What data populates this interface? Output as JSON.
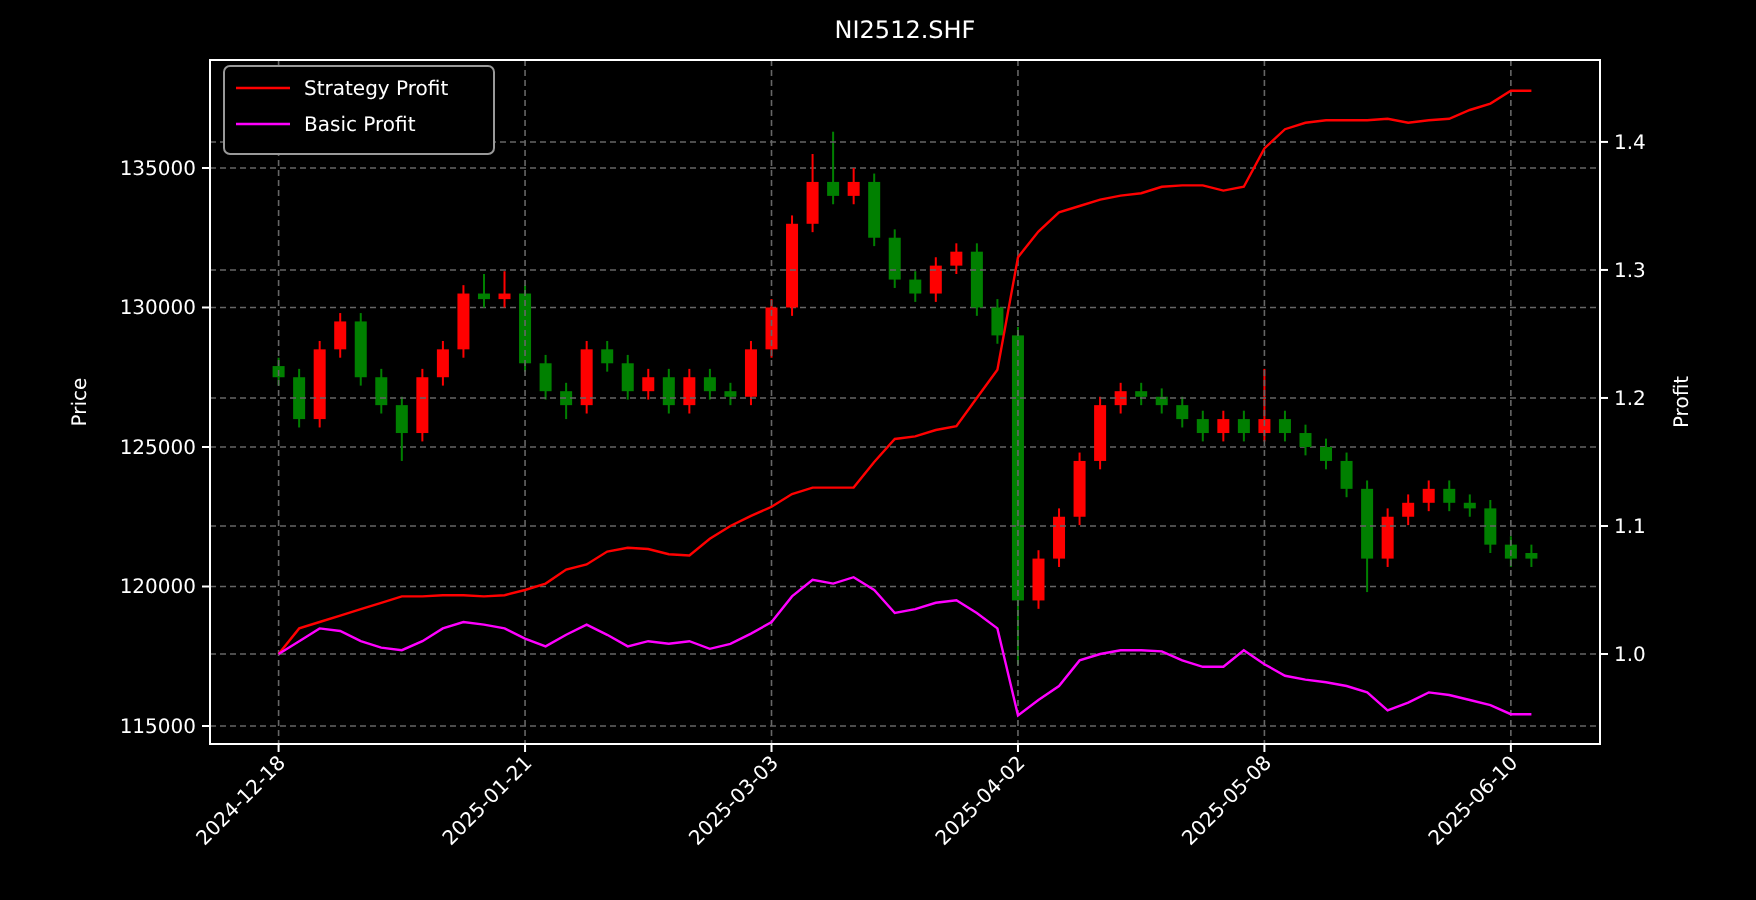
{
  "profit_chart": {
    "chart_data": {
      "type": "line",
      "title": "NI2512.SHF",
      "ylabel": "Profit",
      "grid": true,
      "legend": true,
      "categories": [
        "2024-12-18",
        null,
        null,
        null,
        null,
        null,
        null,
        null,
        null,
        null,
        null,
        null,
        "2025-01-21",
        null,
        null,
        null,
        null,
        null,
        null,
        null,
        null,
        null,
        null,
        null,
        "2025-03-03",
        null,
        null,
        null,
        null,
        null,
        null,
        null,
        null,
        null,
        null,
        null,
        "2025-04-02",
        null,
        null,
        null,
        null,
        null,
        null,
        null,
        null,
        null,
        null,
        null,
        "2025-05-08",
        null,
        null,
        null,
        null,
        null,
        null,
        null,
        null,
        null,
        null,
        null,
        "2025-06-10",
        null
      ],
      "ylim": [
        0.9297,
        1.464
      ],
      "yticks": [
        {
          "value": 1.0,
          "label": "1.0"
        },
        {
          "value": 1.1,
          "label": "1.1"
        },
        {
          "value": 1.2,
          "label": "1.2"
        },
        {
          "value": 1.3,
          "label": "1.3"
        },
        {
          "value": 1.4,
          "label": "1.4"
        }
      ],
      "series": [
        {
          "name": "Strategy Profit",
          "color": "#ff0000",
          "values": [
            1.0,
            1.02,
            1.025,
            1.03,
            1.035,
            1.04,
            1.045,
            1.045,
            1.046,
            1.046,
            1.045,
            1.046,
            1.05,
            1.055,
            1.066,
            1.07,
            1.08,
            1.083,
            1.082,
            1.078,
            1.077,
            1.09,
            1.1,
            1.108,
            1.115,
            1.125,
            1.13,
            1.13,
            1.13,
            1.15,
            1.168,
            1.17,
            1.175,
            1.178,
            1.2,
            1.222,
            1.31,
            1.33,
            1.345,
            1.35,
            1.355,
            1.358,
            1.36,
            1.365,
            1.366,
            1.366,
            1.362,
            1.365,
            1.395,
            1.41,
            1.415,
            1.417,
            1.417,
            1.417,
            1.418,
            1.415,
            1.417,
            1.418,
            1.425,
            1.43,
            1.44,
            1.44
          ]
        },
        {
          "name": "Basic Profit",
          "color": "#ff00ff",
          "values": [
            1.0,
            1.01,
            1.02,
            1.018,
            1.01,
            1.005,
            1.003,
            1.01,
            1.02,
            1.025,
            1.023,
            1.02,
            1.012,
            1.006,
            1.015,
            1.023,
            1.015,
            1.006,
            1.01,
            1.008,
            1.01,
            1.004,
            1.008,
            1.016,
            1.025,
            1.045,
            1.058,
            1.055,
            1.06,
            1.05,
            1.032,
            1.035,
            1.04,
            1.042,
            1.032,
            1.02,
            0.952,
            0.964,
            0.975,
            0.995,
            1.0,
            1.003,
            1.003,
            1.002,
            0.995,
            0.99,
            0.99,
            1.003,
            0.992,
            0.983,
            0.98,
            0.978,
            0.975,
            0.97,
            0.956,
            0.962,
            0.97,
            0.968,
            0.964,
            0.96,
            0.953,
            0.953
          ]
        }
      ]
    }
  },
  "price_chart": {
    "chart_data": {
      "type": "candlestick",
      "ylabel": "Price",
      "grid": true,
      "ylim": [
        114355,
        138870
      ],
      "yticks": [
        {
          "value": 115000,
          "label": "115000"
        },
        {
          "value": 120000,
          "label": "120000"
        },
        {
          "value": 125000,
          "label": "125000"
        },
        {
          "value": 130000,
          "label": "130000"
        },
        {
          "value": 135000,
          "label": "135000"
        }
      ],
      "ohlc": [
        [
          127900,
          128200,
          127200,
          127500
        ],
        [
          127500,
          127800,
          125700,
          126000
        ],
        [
          126000,
          128800,
          125700,
          128500
        ],
        [
          128500,
          129800,
          128200,
          129500
        ],
        [
          129500,
          129800,
          127200,
          127500
        ],
        [
          127500,
          127800,
          126200,
          126500
        ],
        [
          126500,
          126800,
          124500,
          125500
        ],
        [
          125500,
          127800,
          125200,
          127500
        ],
        [
          127500,
          128800,
          127200,
          128500
        ],
        [
          128500,
          130800,
          128200,
          130500
        ],
        [
          130500,
          131200,
          130000,
          130300
        ],
        [
          130300,
          131300,
          130000,
          130500
        ],
        [
          130500,
          130800,
          127700,
          128000
        ],
        [
          128000,
          128300,
          126700,
          127000
        ],
        [
          127000,
          127300,
          126000,
          126500
        ],
        [
          126500,
          128800,
          126200,
          128500
        ],
        [
          128500,
          128800,
          127700,
          128000
        ],
        [
          128000,
          128300,
          126700,
          127000
        ],
        [
          127000,
          127800,
          126700,
          127500
        ],
        [
          127500,
          127800,
          126200,
          126500
        ],
        [
          126500,
          127800,
          126200,
          127500
        ],
        [
          127500,
          127800,
          126700,
          127000
        ],
        [
          127000,
          127300,
          126500,
          126800
        ],
        [
          126800,
          128800,
          126500,
          128500
        ],
        [
          128500,
          130300,
          128200,
          130000
        ],
        [
          130000,
          133300,
          129700,
          133000
        ],
        [
          133000,
          135500,
          132700,
          134500
        ],
        [
          134500,
          136300,
          133700,
          134000
        ],
        [
          134000,
          135000,
          133700,
          134500
        ],
        [
          134500,
          134800,
          132200,
          132500
        ],
        [
          132500,
          132800,
          130700,
          131000
        ],
        [
          131000,
          131300,
          130200,
          130500
        ],
        [
          130500,
          131800,
          130200,
          131500
        ],
        [
          131500,
          132300,
          131200,
          132000
        ],
        [
          132000,
          132300,
          129700,
          130000
        ],
        [
          130000,
          130300,
          128700,
          129000
        ],
        [
          129000,
          129300,
          117200,
          119500
        ],
        [
          119500,
          121300,
          119200,
          121000
        ],
        [
          121000,
          122800,
          120700,
          122500
        ],
        [
          122500,
          124800,
          122200,
          124500
        ],
        [
          124500,
          126800,
          124200,
          126500
        ],
        [
          126500,
          127300,
          126200,
          127000
        ],
        [
          127000,
          127300,
          126500,
          126800
        ],
        [
          126800,
          127100,
          126200,
          126500
        ],
        [
          126500,
          126800,
          125700,
          126000
        ],
        [
          126000,
          126300,
          125200,
          125500
        ],
        [
          125500,
          126300,
          125200,
          126000
        ],
        [
          126000,
          126300,
          125200,
          125500
        ],
        [
          125500,
          127800,
          125200,
          126000
        ],
        [
          126000,
          126300,
          125200,
          125500
        ],
        [
          125500,
          125800,
          124700,
          125000
        ],
        [
          125000,
          125300,
          124200,
          124500
        ],
        [
          124500,
          124800,
          123200,
          123500
        ],
        [
          123500,
          123800,
          119800,
          121000
        ],
        [
          121000,
          122800,
          120700,
          122500
        ],
        [
          122500,
          123300,
          122200,
          123000
        ],
        [
          123000,
          123800,
          122700,
          123500
        ],
        [
          123500,
          123800,
          122700,
          123000
        ],
        [
          123000,
          123300,
          122500,
          122800
        ],
        [
          122800,
          123100,
          121200,
          121500
        ],
        [
          121500,
          121800,
          120700,
          121000
        ],
        [
          121200,
          121500,
          120700,
          121000
        ]
      ]
    }
  }
}
